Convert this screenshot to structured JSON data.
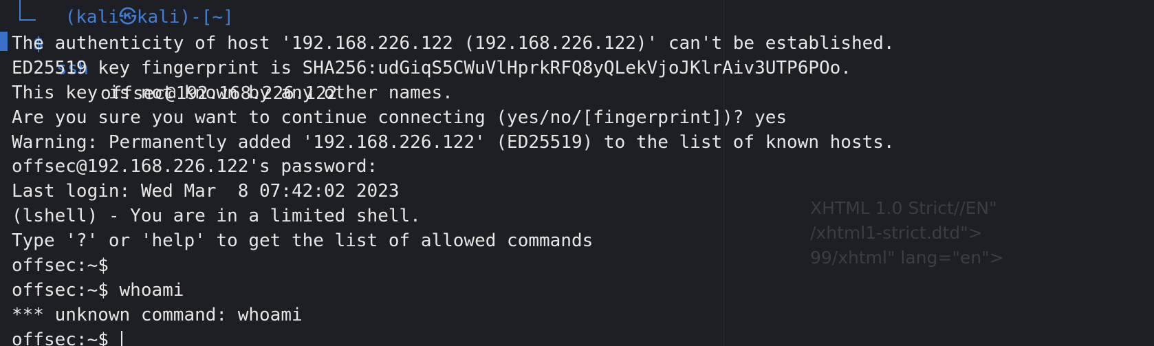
{
  "window": {
    "top_prompt_partial": "(kali㉿kali)-[~]"
  },
  "command": {
    "prompt_symbol": "$",
    "name": "ssh",
    "args": "offsec@192.168.226.122"
  },
  "output_lines": [
    "The authenticity of host '192.168.226.122 (192.168.226.122)' can't be established.",
    "ED25519 key fingerprint is SHA256:udGiqS5CWuVlHprkRFQ8yQLekVjoJKlrAiv3UTP6POo.",
    "This key is not known by any other names.",
    "Are you sure you want to continue connecting (yes/no/[fingerprint])? yes",
    "Warning: Permanently added '192.168.226.122' (ED25519) to the list of known hosts.",
    "offsec@192.168.226.122's password: ",
    "Last login: Wed Mar  8 07:42:02 2023",
    "(lshell) - You are in a limited shell.",
    "Type '?' or 'help' to get the list of allowed commands",
    "offsec:~$ ",
    "offsec:~$ whoami",
    "*** unknown command: whoami",
    "offsec:~$ "
  ],
  "background_ghost_text": [
    "XHTML 1.0 Strict//EN\"",
    "/xhtml1-strict.dtd\">",
    "99/xhtml\" lang=\"en\">"
  ],
  "colors": {
    "background": "#1d1f24",
    "text": "#e6e6e6",
    "prompt_accent": "#3f7fd6"
  }
}
